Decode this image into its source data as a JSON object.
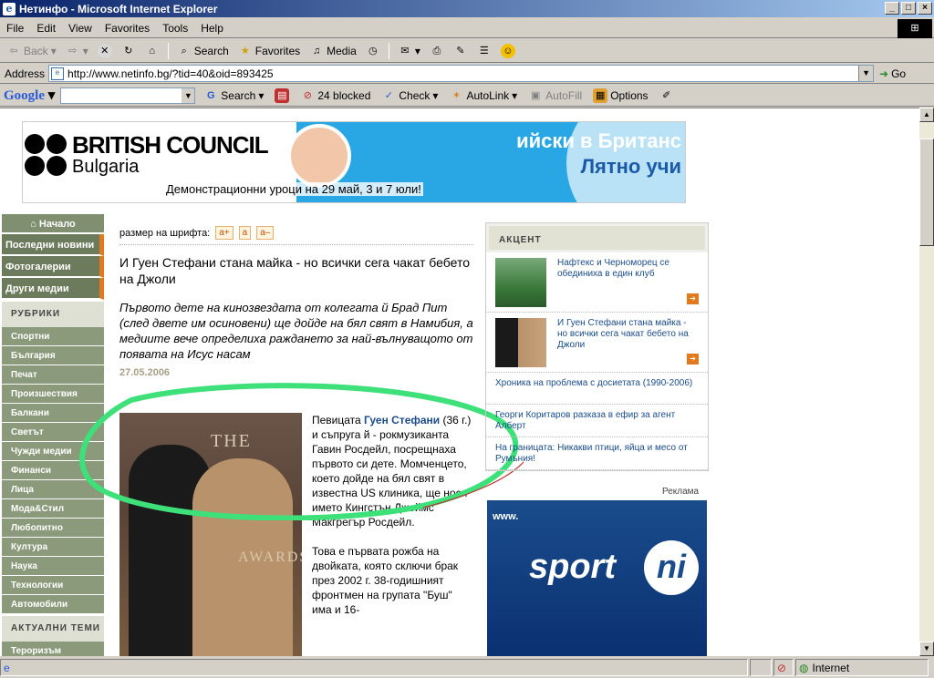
{
  "window": {
    "title": "Нетинфо - Microsoft Internet Explorer"
  },
  "menu": [
    "File",
    "Edit",
    "View",
    "Favorites",
    "Tools",
    "Help"
  ],
  "toolbar": {
    "back": "Back",
    "search": "Search",
    "favorites": "Favorites",
    "media": "Media"
  },
  "address": {
    "label": "Address",
    "url": "http://www.netinfo.bg/?tid=40&oid=893425",
    "go": "Go"
  },
  "google": {
    "logo": "Google",
    "search": "Search",
    "blocked": "24 blocked",
    "check": "Check",
    "autolink": "AutoLink",
    "autofill": "AutoFill",
    "options": "Options"
  },
  "banner": {
    "brand": "BRITISH COUNCIL",
    "country": "Bulgaria",
    "line1": "ийски в Британс",
    "line2": "Лятно учи",
    "demo": "Демонстрационни уроци на 29 май, 3 и 7 юли!"
  },
  "nav": {
    "home": "Начало",
    "main": [
      "Последни новини",
      "Фотогалерии",
      "Други медии"
    ],
    "rubrics_head": "РУБРИКИ",
    "rubrics": [
      "Спортни",
      "България",
      "Печат",
      "Произшествия",
      "Балкани",
      "Светът",
      "Чужди медии",
      "Финанси",
      "Лица",
      "Мода&Стил",
      "Любопитно",
      "Култура",
      "Наука",
      "Технологии",
      "Автомобили"
    ],
    "topics_head": "АКТУАЛНИ ТЕМИ",
    "topics": [
      "Тероризъм"
    ]
  },
  "article": {
    "fontsize_label": "размер на шрифта:",
    "fs_plus": "a+",
    "fs_norm": "a",
    "fs_minus": "a–",
    "title": "И Гуен Стефани стана майка - но всички сега чакат бебето на Джоли",
    "lead": "Първото дете на кинозвездата от колегата й Брад Пит (след двете им осиновени) ще дойде на бял свят в Намибия, а медиите вече определиха раждането за най-вълнуващото от появата на Исус насам",
    "date": "27.05.2006",
    "body_prefix": "Певицата ",
    "body_name": "Гуен Стефани",
    "body_p1": " (36 г.) и съпруга й - рокмузиканта Гавин Росдейл, посрещнаха първото си дете. Момченцето, което дойде на бял свят в известна US клиника, ще носи името Кингстън Джеймс Макгрегър Росдейл.",
    "body_p2": "Това е първата рожба на двойката, която сключи брак през 2002 г. 38-годишният фронтмен на групата \"Буш\" има и 16-",
    "photo_text1": "THE",
    "photo_text2": "AWARDS"
  },
  "accent": {
    "header": "АКЦЕНТ",
    "items": [
      {
        "text": "Нафтекс и Черноморец се обединиха в един клуб"
      },
      {
        "text": "И Гуен Стефани стана майка - но всички сега чакат бебето на Джоли"
      }
    ],
    "links": [
      "Хроника на проблема с досиетата (1990-2006)",
      "Георги Коритаров разказа в ефир за агент Алберт",
      "На границата: Никакви птици, яйца и месо от Румъния!"
    ]
  },
  "ad": {
    "label": "Реклама",
    "sport": "sport",
    "ni": "ni",
    "www": "www."
  },
  "status": {
    "zone": "Internet"
  }
}
